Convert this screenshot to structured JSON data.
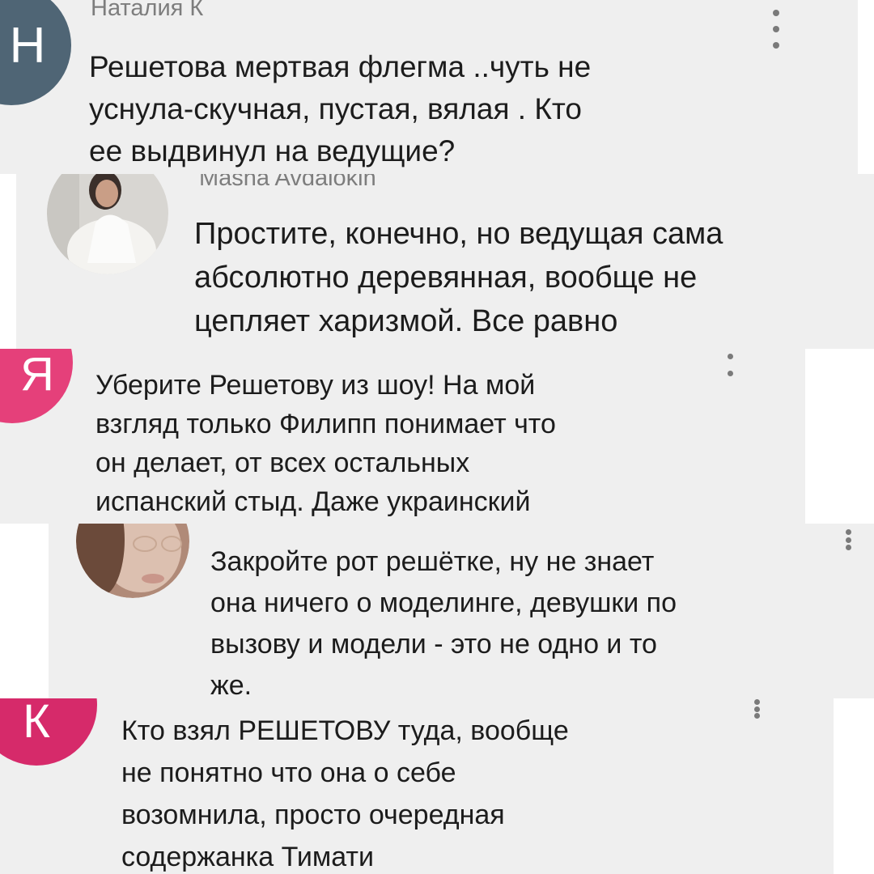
{
  "comments": [
    {
      "author": "Наталия К",
      "avatar_letter": "Н",
      "avatar_color": "#4f6575",
      "text": "Решетова мертвая флегма ..чуть не\nуснула-скучная, пустая, вялая . Кто\nее выдвинул на ведущие?",
      "menu_icon": "more-vertical-icon"
    },
    {
      "author": "Masha Avdalokin",
      "avatar_type": "photo",
      "text": "Простите, конечно, но ведущая сама\nабсолютно деревянная, вообще не\nцепляет харизмой. Все равно"
    },
    {
      "avatar_letter": "Я",
      "avatar_color": "#e5407a",
      "text": "Уберите Решетову из шоу! На мой\nвзгляд только Филипп понимает что\nон делает, от всех остальных\nиспанский стыд. Даже украинский",
      "menu_icon": "more-vertical-icon"
    },
    {
      "avatar_type": "photo",
      "text": "Закройте рот решётке, ну не знает\nона ничего о моделинге, девушки по\nвызову и модели - это не одно и то\nже.",
      "menu_icon": "more-vertical-icon"
    },
    {
      "avatar_letter": "К",
      "avatar_color": "#d62a6a",
      "text": "Кто взял РЕШЕТОВУ туда, вообще\nне понятно что она о себе\nвозомнила, просто очередная\nсодержанка Тимати",
      "menu_icon": "more-vertical-icon"
    }
  ]
}
